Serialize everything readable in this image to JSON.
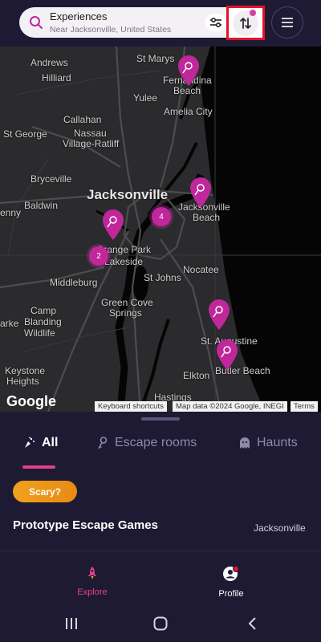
{
  "search": {
    "title": "Experiences",
    "subtitle": "Near Jacksonville, United States",
    "search_icon": "search-icon"
  },
  "toolbar": {
    "filter_icon": "sliders-icon",
    "sort_icon": "sort-arrows-icon",
    "menu_icon": "hamburger-menu-icon"
  },
  "map": {
    "labels": {
      "st_marys": "St Marys",
      "andrews": "Andrews",
      "hilliard": "Hilliard",
      "fernandina": "Fernandina",
      "beach1": "Beach",
      "yulee": "Yulee",
      "amelia": "Amelia City",
      "callahan": "Callahan",
      "st_george": "St George",
      "nassau": "Nassau",
      "village_ratliff": "Village-Ratliff",
      "bryceville": "Bryceville",
      "baldwin": "Baldwin",
      "jacksonville": "Jacksonville",
      "jax_beach1": "Jacksonville",
      "jax_beach2": "Beach",
      "enny": "enny",
      "orange_park": "Orange Park",
      "lakeside": "Lakeside",
      "middleburg": "Middleburg",
      "st_johns": "St Johns",
      "nocatee": "Nocatee",
      "green_cove1": "Green Cove",
      "green_cove2": "Springs",
      "camp1": "Camp",
      "camp2": "Blanding",
      "camp3": "Wildlife",
      "arke": "arke",
      "st_augustine": "St. Augustine",
      "keystone1": "Keystone",
      "keystone2": "Heights",
      "elkton": "Elkton",
      "butler": "Butler Beach",
      "hastings": "Hastings"
    },
    "clusters": [
      "4",
      "2"
    ],
    "google_logo": "Google",
    "attrib_shortcuts": "Keyboard shortcuts",
    "attrib_data": "Map data ©2024 Google, INEGI",
    "attrib_terms": "Terms",
    "pin_color": "#c0279a"
  },
  "tabs": [
    {
      "label": "All",
      "icon": "sparkle-icon",
      "active": true
    },
    {
      "label": "Escape rooms",
      "icon": "key-icon",
      "active": false
    },
    {
      "label": "Haunts",
      "icon": "ghost-icon",
      "active": false
    }
  ],
  "listing": {
    "badge": "Scary?",
    "title": "Prototype Escape Games",
    "city": "Jacksonville"
  },
  "bottom_nav": {
    "explore": "Explore",
    "profile": "Profile",
    "accent": "#e0408f"
  }
}
